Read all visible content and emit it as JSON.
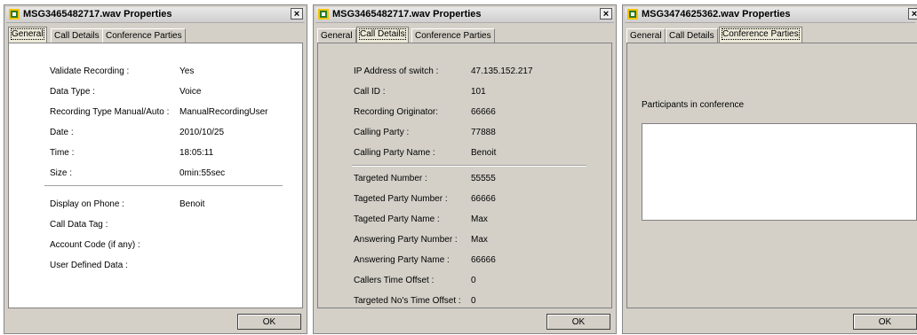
{
  "dialogs": [
    {
      "title": "MSG3465482717.wav Properties",
      "tabs": [
        "General",
        "Call Details",
        "Conference Parties"
      ],
      "general": [
        {
          "label": "Validate Recording :",
          "value": "Yes"
        },
        {
          "label": "Data Type :",
          "value": "Voice"
        },
        {
          "label": "Recording Type Manual/Auto :",
          "value": "ManualRecordingUser"
        },
        {
          "label": "Date :",
          "value": "2010/10/25"
        },
        {
          "label": "Time :",
          "value": "18:05:11"
        },
        {
          "label": "Size :",
          "value": "0min:55sec"
        },
        {
          "label": "Display on Phone :",
          "value": "Benoit"
        },
        {
          "label": "Call Data Tag :",
          "value": ""
        },
        {
          "label": "Account Code (if any) :",
          "value": ""
        },
        {
          "label": "User Defined Data :",
          "value": ""
        }
      ],
      "ok_label": "OK"
    },
    {
      "title": "MSG3465482717.wav Properties",
      "tabs": [
        "General",
        "Call Details",
        "Conference Parties"
      ],
      "details": [
        {
          "label": "IP Address of switch :",
          "value": "47.135.152.217"
        },
        {
          "label": "Call ID :",
          "value": "101"
        },
        {
          "label": "Recording Originator:",
          "value": "66666"
        },
        {
          "label": "Calling Party :",
          "value": "77888"
        },
        {
          "label": "Calling Party Name :",
          "value": "Benoit"
        },
        {
          "label": "Targeted Number :",
          "value": "55555"
        },
        {
          "label": "Tageted Party Number :",
          "value": "66666"
        },
        {
          "label": "Tageted Party Name :",
          "value": "Max"
        },
        {
          "label": "Answering Party Number :",
          "value": "Max"
        },
        {
          "label": "Answering Party Name :",
          "value": "66666"
        },
        {
          "label": "Callers Time Offset :",
          "value": "0"
        },
        {
          "label": "Targeted No's Time Offset :",
          "value": "0"
        }
      ],
      "ok_label": "OK"
    },
    {
      "title": "MSG3474625362.wav Properties",
      "tabs": [
        "General",
        "Call Details",
        "Conference Parties"
      ],
      "participants_label": "Participants in conference",
      "ok_label": "OK"
    }
  ],
  "close_glyph": "×"
}
